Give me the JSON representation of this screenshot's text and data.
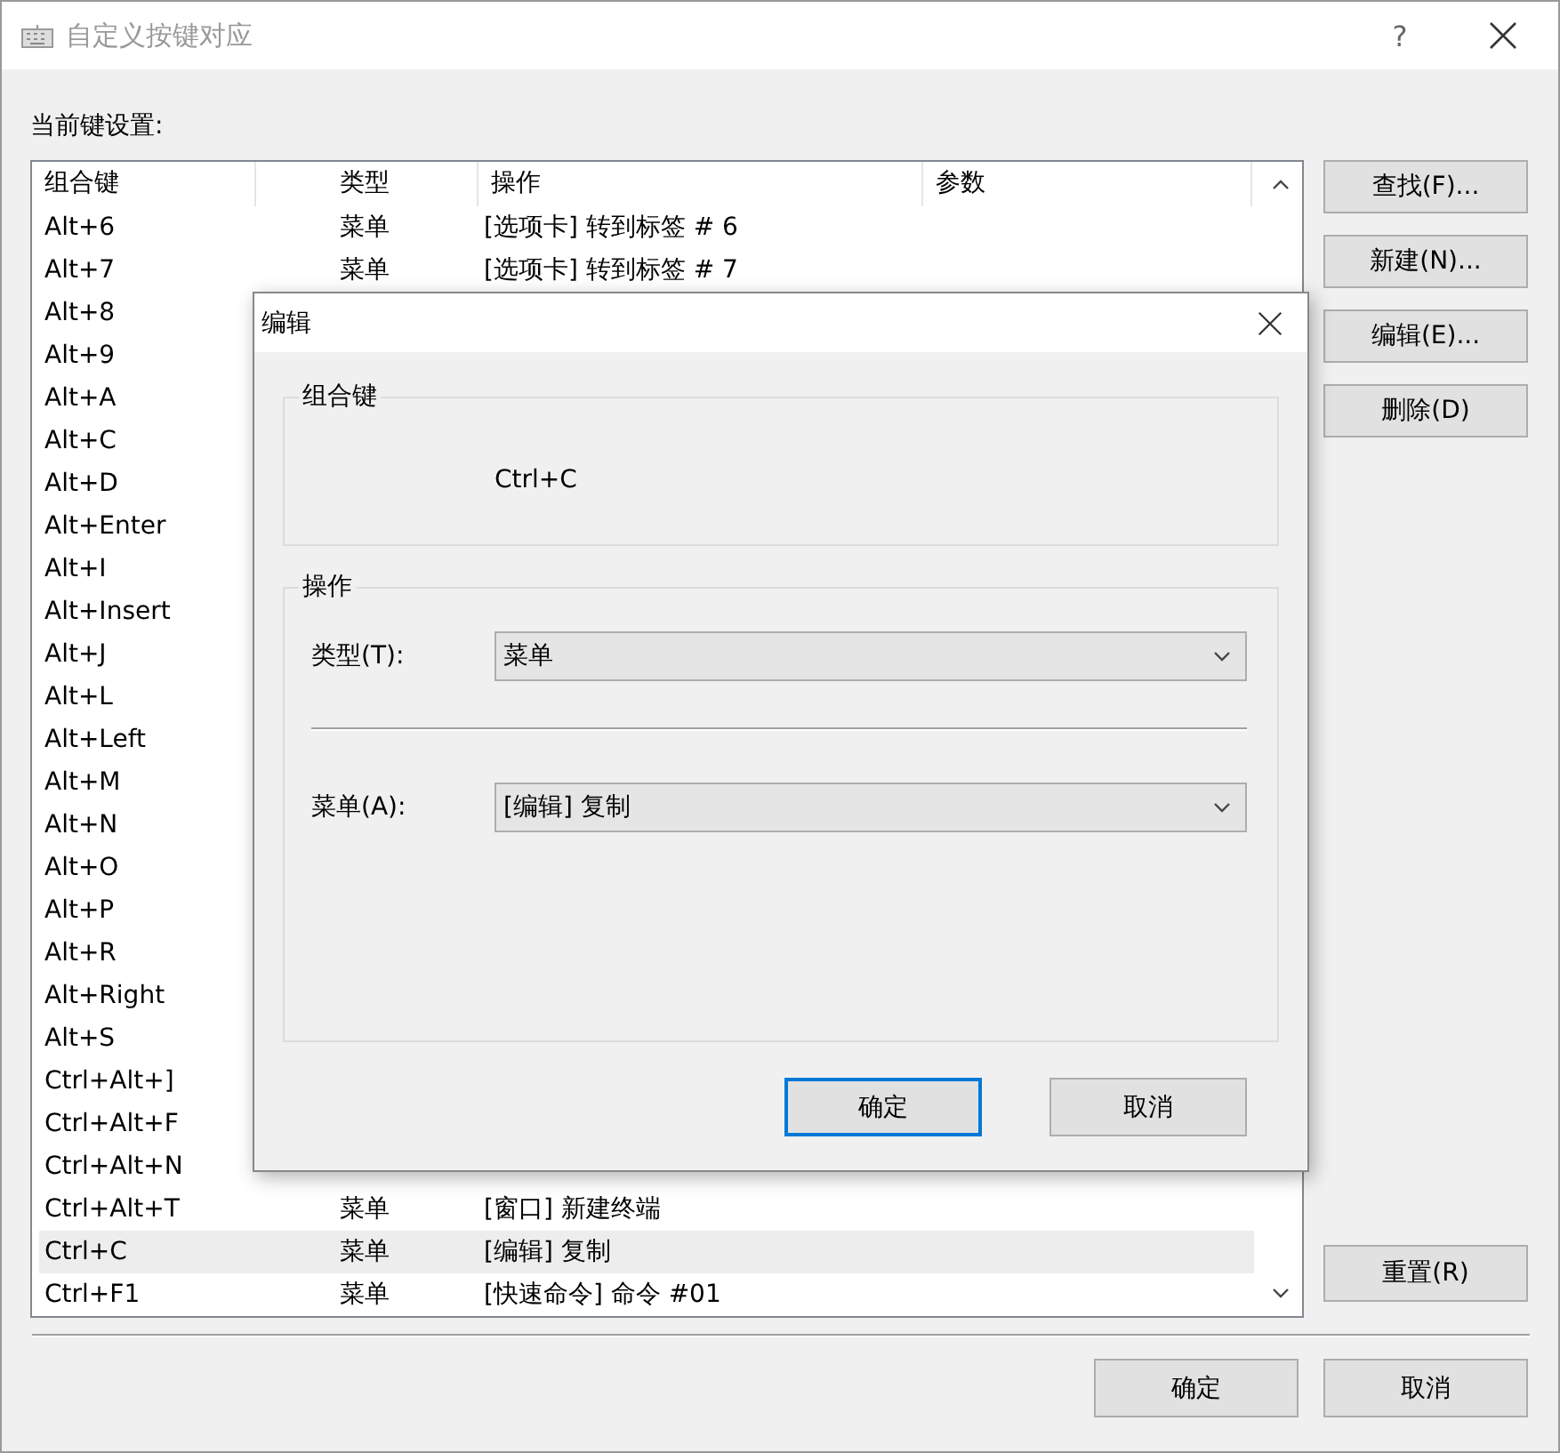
{
  "window": {
    "title": "自定义按键对应",
    "help": "?"
  },
  "list_label": "当前键设置:",
  "table": {
    "columns": [
      "组合键",
      "类型",
      "操作",
      "参数"
    ],
    "rows": [
      {
        "key": "Alt+6",
        "type": "菜单",
        "action": "[选项卡] 转到标签 # 6",
        "selected": false
      },
      {
        "key": "Alt+7",
        "type": "菜单",
        "action": "[选项卡] 转到标签 # 7",
        "selected": false
      },
      {
        "key": "Alt+8",
        "selected": false
      },
      {
        "key": "Alt+9",
        "selected": false
      },
      {
        "key": "Alt+A",
        "selected": false
      },
      {
        "key": "Alt+C",
        "selected": false
      },
      {
        "key": "Alt+D",
        "selected": false
      },
      {
        "key": "Alt+Enter",
        "selected": false
      },
      {
        "key": "Alt+I",
        "selected": false
      },
      {
        "key": "Alt+Insert",
        "selected": false
      },
      {
        "key": "Alt+J",
        "selected": false
      },
      {
        "key": "Alt+L",
        "selected": false
      },
      {
        "key": "Alt+Left",
        "selected": false
      },
      {
        "key": "Alt+M",
        "selected": false
      },
      {
        "key": "Alt+N",
        "selected": false
      },
      {
        "key": "Alt+O",
        "selected": false
      },
      {
        "key": "Alt+P",
        "selected": false
      },
      {
        "key": "Alt+R",
        "selected": false
      },
      {
        "key": "Alt+Right",
        "selected": false
      },
      {
        "key": "Alt+S",
        "selected": false
      },
      {
        "key": "Ctrl+Alt+]",
        "selected": false
      },
      {
        "key": "Ctrl+Alt+F",
        "selected": false
      },
      {
        "key": "Ctrl+Alt+N",
        "selected": false
      },
      {
        "key": "Ctrl+Alt+T",
        "type": "菜单",
        "action": "[窗口] 新建终端",
        "selected": false
      },
      {
        "key": "Ctrl+C",
        "type": "菜单",
        "action": "[编辑] 复制",
        "selected": true
      },
      {
        "key": "Ctrl+F1",
        "type": "菜单",
        "action": "[快速命令] 命令 #01",
        "selected": false
      }
    ]
  },
  "side_buttons": [
    "查找(F)...",
    "新建(N)...",
    "编辑(E)...",
    "删除(D)"
  ],
  "reset_button": "重置(R)",
  "footer_buttons": [
    "确定",
    "取消"
  ],
  "dialog": {
    "title": "编辑",
    "key_group": {
      "title": "组合键",
      "value": "Ctrl+C"
    },
    "action_group": {
      "title": "操作",
      "fields": [
        {
          "label": "类型(T):",
          "value": "菜单"
        },
        {
          "label": "菜单(A):",
          "value": "[编辑] 复制"
        }
      ]
    },
    "buttons": [
      {
        "label": "确定",
        "focused": true
      },
      {
        "label": "取消",
        "focused": false
      }
    ]
  }
}
